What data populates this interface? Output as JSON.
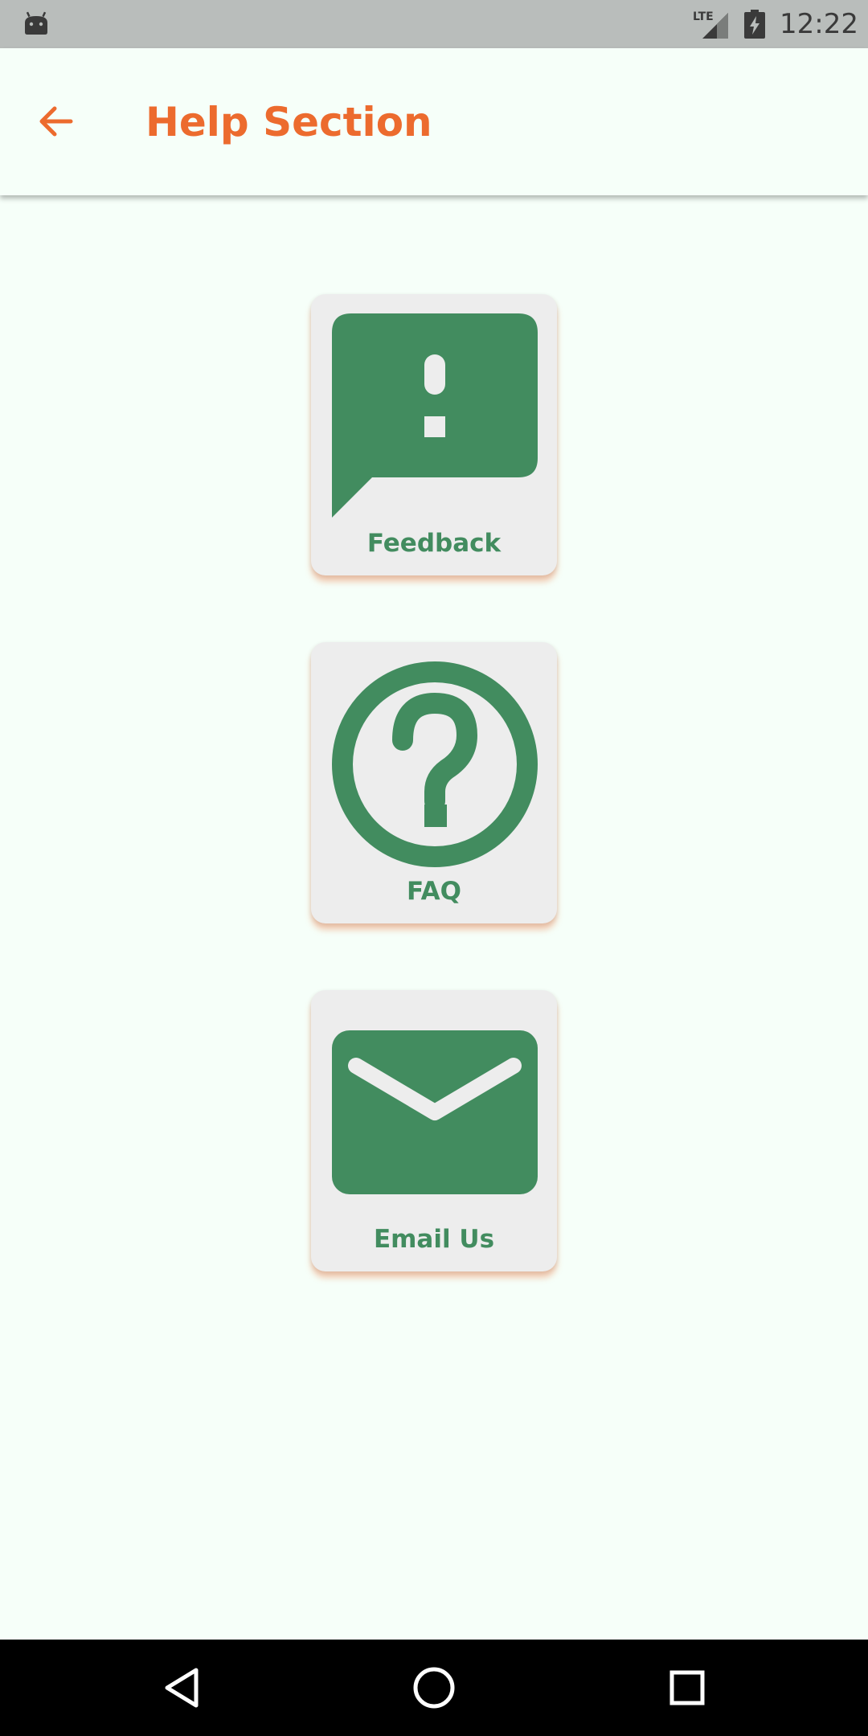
{
  "status_bar": {
    "time": "12:22",
    "network": "LTE",
    "icons": [
      "android-debug-icon",
      "lte-signal-icon",
      "battery-charging-icon"
    ]
  },
  "app_bar": {
    "title": "Help Section",
    "back_icon": "arrow-left-icon"
  },
  "cards": [
    {
      "label": "Feedback",
      "icon": "feedback-icon"
    },
    {
      "label": "FAQ",
      "icon": "help-circle-icon"
    },
    {
      "label": "Email Us",
      "icon": "email-icon"
    }
  ],
  "nav_bar": {
    "icons": [
      "back-triangle-icon",
      "home-circle-icon",
      "recents-square-icon"
    ]
  },
  "colors": {
    "accent": "#ec6b2e",
    "icon_green": "#428c5f",
    "background": "#f6fff9",
    "card": "#ededed",
    "status_bar": "#b9bdbb",
    "nav_bar": "#000000"
  }
}
